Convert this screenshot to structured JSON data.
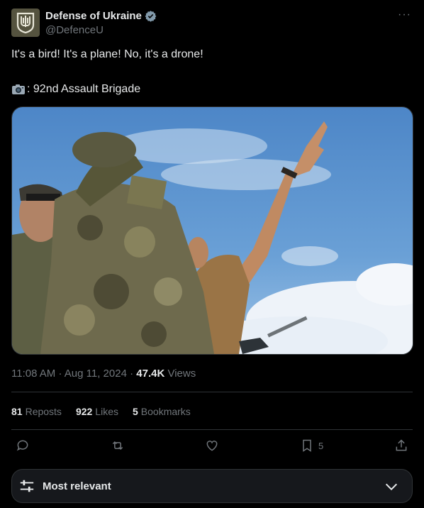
{
  "author": {
    "display_name": "Defense of Ukraine",
    "handle": "@DefenceU",
    "verified_icon": "verified-badge-icon",
    "avatar_icon": "trident-emblem-icon"
  },
  "post": {
    "line1": "It's a bird! It's a plane! No, it's a drone!",
    "line2_icon": "camera-emoji",
    "line2_text": ": 92nd Assault Brigade",
    "image_description_icon": "soldiers-photo"
  },
  "meta": {
    "time": "11:08 AM",
    "separator": "·",
    "date": "Aug 11, 2024",
    "views_count": "47.4K",
    "views_label": "Views"
  },
  "stats": {
    "reposts_count": "81",
    "reposts_label": "Reposts",
    "likes_count": "922",
    "likes_label": "Likes",
    "bookmarks_count": "5",
    "bookmarks_label": "Bookmarks"
  },
  "actions": {
    "bookmark_count": "5"
  },
  "sort": {
    "label": "Most relevant"
  },
  "colors": {
    "background": "#000000",
    "text": "#e7e9ea",
    "muted": "#71767b",
    "verified": "#829aab",
    "divider": "#2f3336"
  }
}
